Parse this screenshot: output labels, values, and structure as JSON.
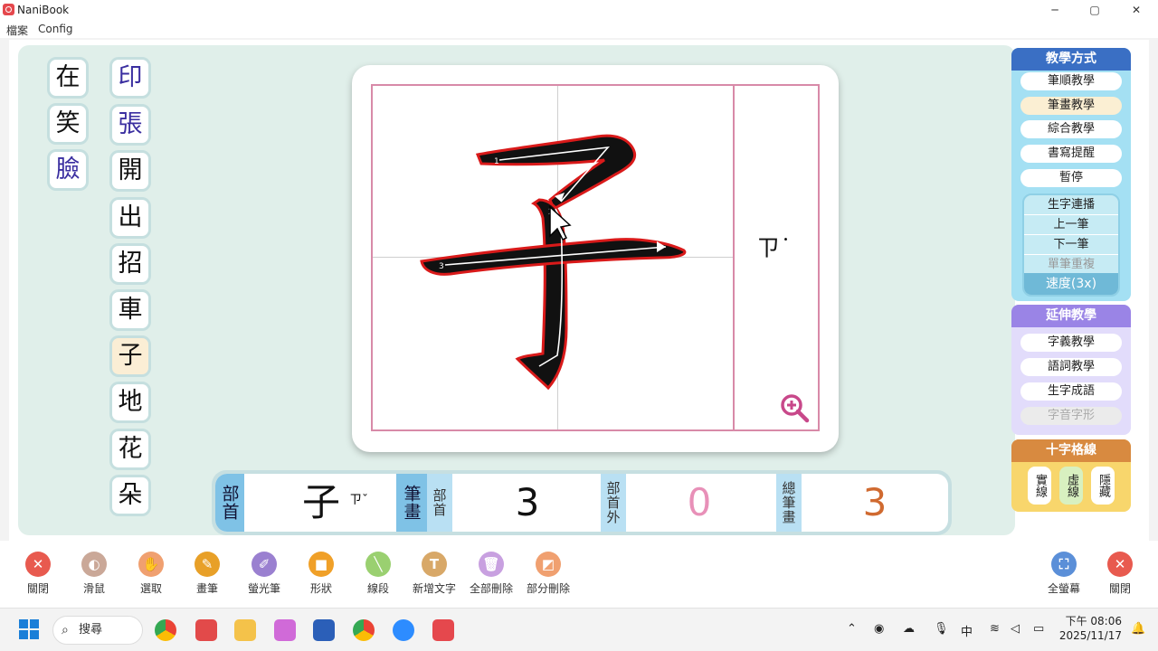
{
  "window": {
    "title": "NaniBook",
    "minimize": "─",
    "maximize": "▢",
    "close": "✕"
  },
  "menu": [
    "檔案",
    "Config"
  ],
  "char_list_col1": [
    {
      "char": "在",
      "purple": false
    },
    {
      "char": "笑",
      "purple": false
    },
    {
      "char": "臉",
      "purple": true
    }
  ],
  "char_list_col2": [
    {
      "char": "印",
      "purple": true
    },
    {
      "char": "張",
      "purple": true
    },
    {
      "char": "開",
      "purple": false
    },
    {
      "char": "出",
      "purple": false
    },
    {
      "char": "招",
      "purple": false
    },
    {
      "char": "車",
      "purple": false
    },
    {
      "char": "子",
      "purple": false,
      "selected": true
    },
    {
      "char": "地",
      "purple": false
    },
    {
      "char": "花",
      "purple": false
    },
    {
      "char": "朵",
      "purple": false
    }
  ],
  "board": {
    "stroke_numbers": [
      "1",
      "2",
      "3"
    ],
    "zhuyin": "ㄗ˙",
    "zoom_icon": "zoom-in-icon"
  },
  "info": {
    "radical_label": "部首",
    "radical_value": "子",
    "radical_zhuyin": "ㄗˇ",
    "strokes_label": "筆畫",
    "radical_strokes_label": "部首",
    "radical_strokes": "3",
    "outside_label": "部首外",
    "outside_strokes": "0",
    "total_label": "總筆畫",
    "total_strokes": "3"
  },
  "teaching": {
    "title": "教學方式",
    "buttons": [
      "筆順教學",
      "筆畫教學",
      "綜合教學",
      "書寫提醒",
      "暫停"
    ],
    "sub": [
      "生字連播",
      "上一筆",
      "下一筆",
      "單筆重複"
    ],
    "speed": "速度(3x)"
  },
  "extended": {
    "title": "延伸教學",
    "buttons": [
      "字義教學",
      "語詞教學",
      "生字成語",
      "字音字形"
    ]
  },
  "cross": {
    "title": "十字格線",
    "buttons": [
      "實線",
      "虛線",
      "隱藏"
    ]
  },
  "tools": [
    {
      "label": "關閉",
      "color": "#e85a4f",
      "glyph": "✕"
    },
    {
      "label": "滑鼠",
      "color": "#caa898",
      "glyph": "◐"
    },
    {
      "label": "選取",
      "color": "#f0a070",
      "glyph": "✋"
    },
    {
      "label": "畫筆",
      "color": "#e8a028",
      "glyph": "✎"
    },
    {
      "label": "螢光筆",
      "color": "#9a80d0",
      "glyph": "✐"
    },
    {
      "label": "形狀",
      "color": "#f0a028",
      "glyph": "■"
    },
    {
      "label": "線段",
      "color": "#9ad070",
      "glyph": "╲"
    },
    {
      "label": "新增文字",
      "color": "#d8a868",
      "glyph": "T"
    },
    {
      "label": "全部刪除",
      "color": "#c8a0e0",
      "glyph": "🗑"
    },
    {
      "label": "部分刪除",
      "color": "#f0a070",
      "glyph": "◩"
    }
  ],
  "right_tools": [
    {
      "label": "全螢幕",
      "color": "#5b8fd8",
      "glyph": "⛶"
    },
    {
      "label": "關閉",
      "color": "#e85a4f",
      "glyph": "✕"
    }
  ],
  "taskbar": {
    "search_placeholder": "搜尋",
    "ime": "中",
    "time": "下午 08:06",
    "date": "2025/11/17"
  }
}
